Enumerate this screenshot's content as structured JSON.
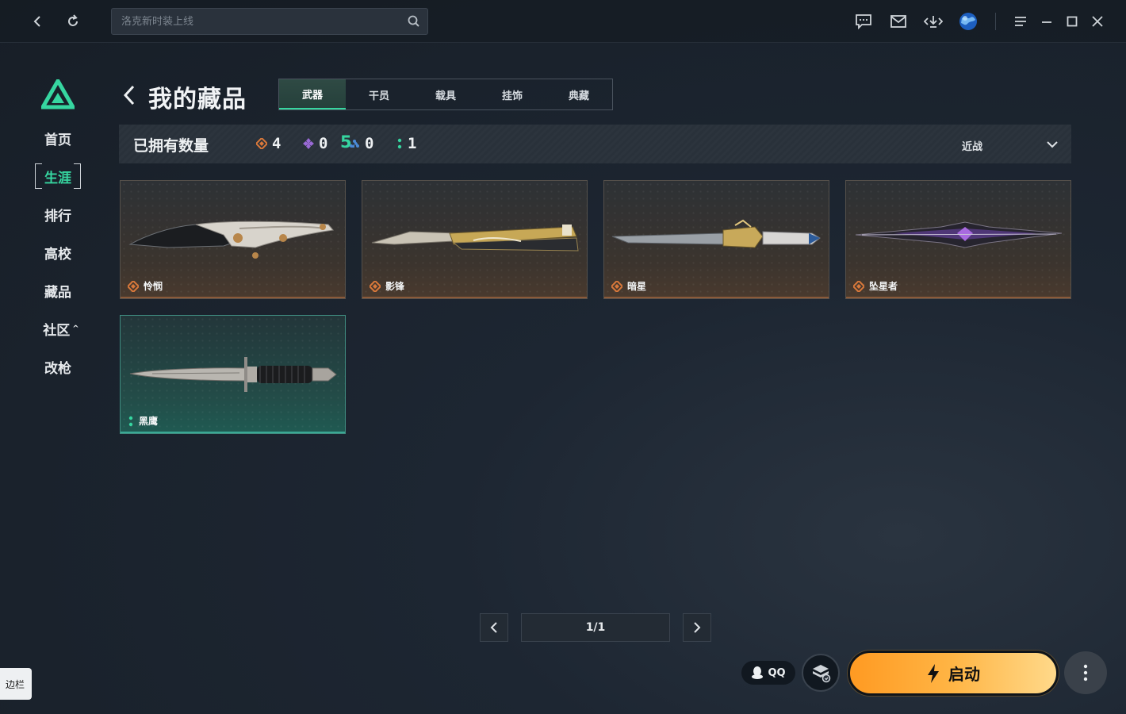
{
  "topbar": {
    "search_placeholder": "洛克新时装上线",
    "icons": [
      "back-icon",
      "refresh-icon",
      "search-icon",
      "message-icon",
      "mail-icon",
      "download-icon",
      "globe-avatar-icon",
      "menu-icon",
      "minimize-icon",
      "maximize-icon",
      "close-icon"
    ]
  },
  "sidebar": {
    "items": [
      {
        "label": "首页"
      },
      {
        "label": "生涯",
        "active": true
      },
      {
        "label": "排行"
      },
      {
        "label": "高校"
      },
      {
        "label": "藏品"
      },
      {
        "label": "社区",
        "caret": "^"
      },
      {
        "label": "改枪"
      }
    ]
  },
  "header": {
    "title": "我的藏品",
    "tabs": [
      {
        "label": "武器",
        "active": true
      },
      {
        "label": "干员"
      },
      {
        "label": "载具"
      },
      {
        "label": "挂饰"
      },
      {
        "label": "典藏"
      }
    ]
  },
  "summary": {
    "label": "已拥有数量",
    "count": "5",
    "rarity": [
      {
        "value": "4",
        "color": "#d9783a",
        "icon": "diamond-orange-icon"
      },
      {
        "value": "0",
        "color": "#9a6ad6",
        "icon": "diamond-purple-icon"
      },
      {
        "value": "0",
        "color": "#4a8ad6",
        "icon": "triangle-blue-icon"
      },
      {
        "value": "1",
        "color": "#36d6a0",
        "icon": "dots-green-icon"
      }
    ],
    "filter_label": "近战"
  },
  "cards": [
    {
      "name": "怜悯",
      "rarity_color": "#d9783a"
    },
    {
      "name": "影锋",
      "rarity_color": "#d9783a"
    },
    {
      "name": "暗星",
      "rarity_color": "#d9783a"
    },
    {
      "name": "坠星者",
      "rarity_color": "#d9783a"
    },
    {
      "name": "黑鹰",
      "rarity_color": "#36d6a0"
    }
  ],
  "pager": {
    "text": "1/1"
  },
  "footer": {
    "qq_label": "QQ",
    "start_label": "启动",
    "side_tip": "边栏"
  },
  "colors": {
    "accent": "#36d6a0",
    "start_orange": "#ffb545"
  }
}
